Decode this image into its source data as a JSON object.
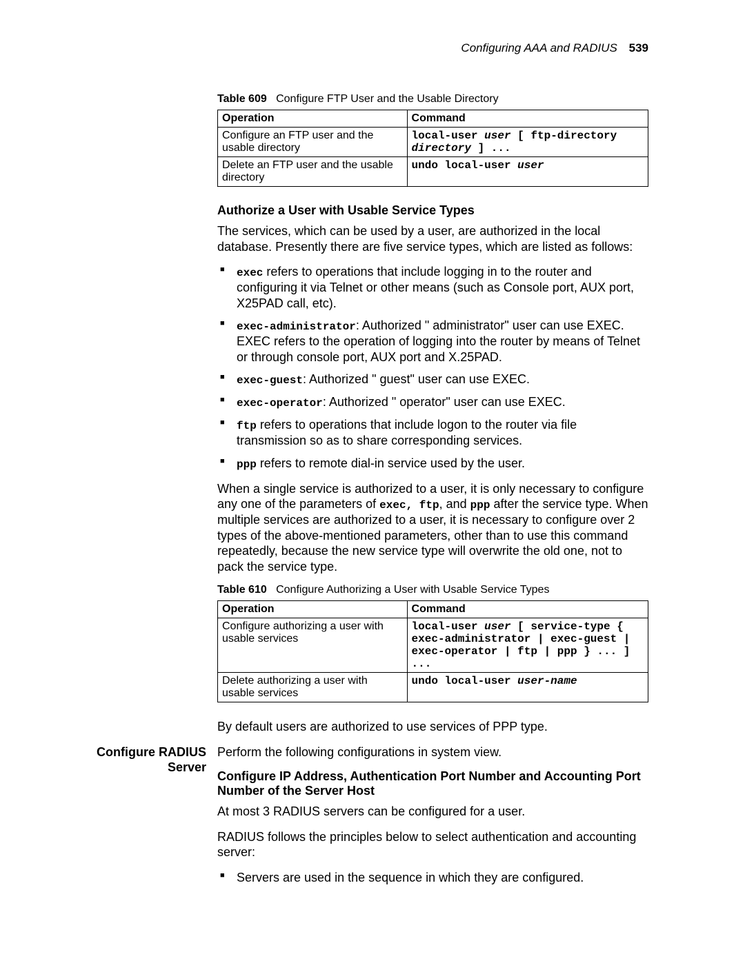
{
  "header": {
    "section": "Configuring AAA and RADIUS",
    "page": "539"
  },
  "table609": {
    "label": "Table 609",
    "caption": "Configure FTP User and the Usable Directory",
    "head_op": "Operation",
    "head_cmd": "Command",
    "rows": [
      {
        "op": "Configure an FTP user and the usable directory",
        "cmd_plain1": "local-user ",
        "cmd_it1": "user",
        "cmd_plain2": " [ ftp-directory ",
        "cmd_it2": "directory",
        "cmd_plain3": " ] ..."
      },
      {
        "op": "Delete an FTP user and the usable directory",
        "cmd_plain1": "undo local-user ",
        "cmd_it1": "user"
      }
    ]
  },
  "sec1": {
    "heading": "Authorize a User with Usable Service Types",
    "intro": "The services, which can be used by a user, are authorized in the local database. Presently there are five service types, which are listed as follows:",
    "bullets": {
      "b1_code": "exec",
      "b1_rest": " refers to operations that include logging in to the router and configuring it via Telnet or other means (such as Console port, AUX port, X25PAD call, etc).",
      "b2_code": "exec-administrator",
      "b2_rest": ": Authorized \" administrator\" user can use EXEC. EXEC refers to the operation of logging into the router by means of Telnet or through console port, AUX port and X.25PAD.",
      "b3_code": "exec-guest",
      "b3_rest": ": Authorized \" guest\" user can use EXEC.",
      "b4_code": "exec-operator",
      "b4_rest": ": Authorized \" operator\" user can use EXEC.",
      "b5_code": "ftp",
      "b5_rest": " refers to operations that include logon to the router via file transmission so as to share corresponding services.",
      "b6_code": "ppp",
      "b6_rest": " refers to remote dial-in service used by the user."
    },
    "para2_a": "When a single service is authorized to a user, it is only necessary to configure any one of the parameters of ",
    "para2_code1": "exec, ftp",
    "para2_mid": ", and ",
    "para2_code2": "ppp",
    "para2_b": " after the service type. When multiple services are authorized to a user, it is necessary to configure over 2 types of the above-mentioned parameters, other than to use this command repeatedly, because the new service type will overwrite the old one, not to pack the service type."
  },
  "table610": {
    "label": "Table 610",
    "caption": "Configure Authorizing a User with Usable Service Types",
    "head_op": "Operation",
    "head_cmd": "Command",
    "rows": [
      {
        "op": "Configure authorizing a user with usable services",
        "cmd_a": "local-user ",
        "cmd_it": "user",
        "cmd_b": " [ service-type { exec-administrator | exec-guest | exec-operator | ftp | ppp } ... ] ..."
      },
      {
        "op": "Delete authorizing a user with usable services",
        "cmd_a": "undo local-user ",
        "cmd_it": "user-name"
      }
    ]
  },
  "after610": "By default users are authorized to use services of PPP type.",
  "sec2": {
    "side": "Configure RADIUS Server",
    "lead": "Perform the following configurations in system view.",
    "h": "Configure IP Address, Authentication Port Number and Accounting Port Number of the Server Host",
    "p1": "At most 3 RADIUS servers can be configured for a user.",
    "p2": "RADIUS follows the principles below to select authentication and accounting server:",
    "b1": "Servers are used in the sequence in which they are configured."
  }
}
